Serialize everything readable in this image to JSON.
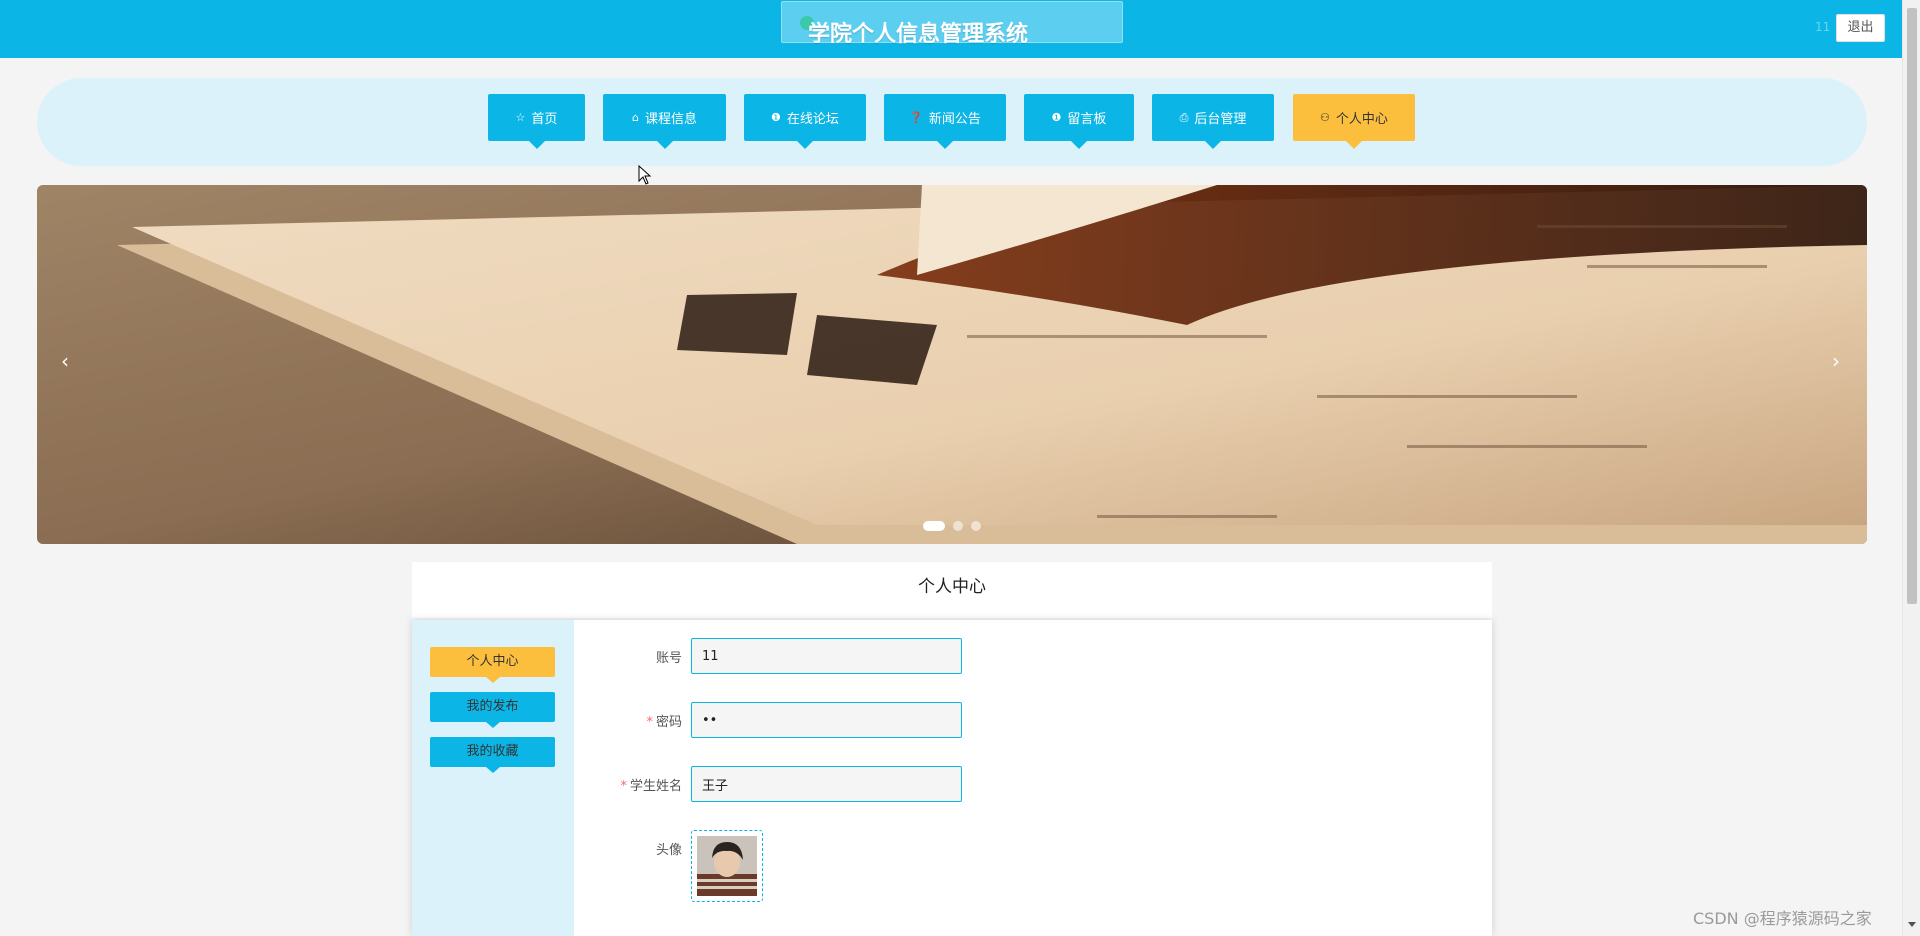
{
  "header": {
    "title": "学院个人信息管理系统",
    "user_name": "11",
    "logout_label": "退出"
  },
  "nav": {
    "items": [
      {
        "label": "首页",
        "icon": "☆",
        "icon_name": "star-icon"
      },
      {
        "label": "课程信息",
        "icon": "⌂",
        "icon_name": "bag-icon"
      },
      {
        "label": "在线论坛",
        "icon": "❶",
        "icon_name": "info-circle-icon"
      },
      {
        "label": "新闻公告",
        "icon": "❓",
        "icon_name": "question-circle-icon"
      },
      {
        "label": "留言板",
        "icon": "❶",
        "icon_name": "info-circle-icon"
      },
      {
        "label": "后台管理",
        "icon": "⎙",
        "icon_name": "clipboard-icon"
      },
      {
        "label": "个人中心",
        "icon": "⚇",
        "icon_name": "user-icon"
      }
    ],
    "active_index": 6
  },
  "banner": {
    "prev": "‹",
    "next": "›",
    "slide_count": 3,
    "active_slide": 0
  },
  "profile": {
    "section_title": "个人中心",
    "side_menu": [
      {
        "label": "个人中心"
      },
      {
        "label": "我的发布"
      },
      {
        "label": "我的收藏"
      }
    ],
    "fields": {
      "account": {
        "label": "账号",
        "value": "11",
        "required": false
      },
      "password": {
        "label": "密码",
        "value": "••",
        "required": true
      },
      "name": {
        "label": "学生姓名",
        "value": "王子",
        "required": true
      },
      "avatar": {
        "label": "头像"
      }
    }
  },
  "watermark": "CSDN @程序猿源码之家",
  "colors": {
    "primary": "#0bb6e6",
    "accent": "#fbbf3d",
    "nav_strip": "#dcf2fb",
    "required": "#f56c6c"
  }
}
